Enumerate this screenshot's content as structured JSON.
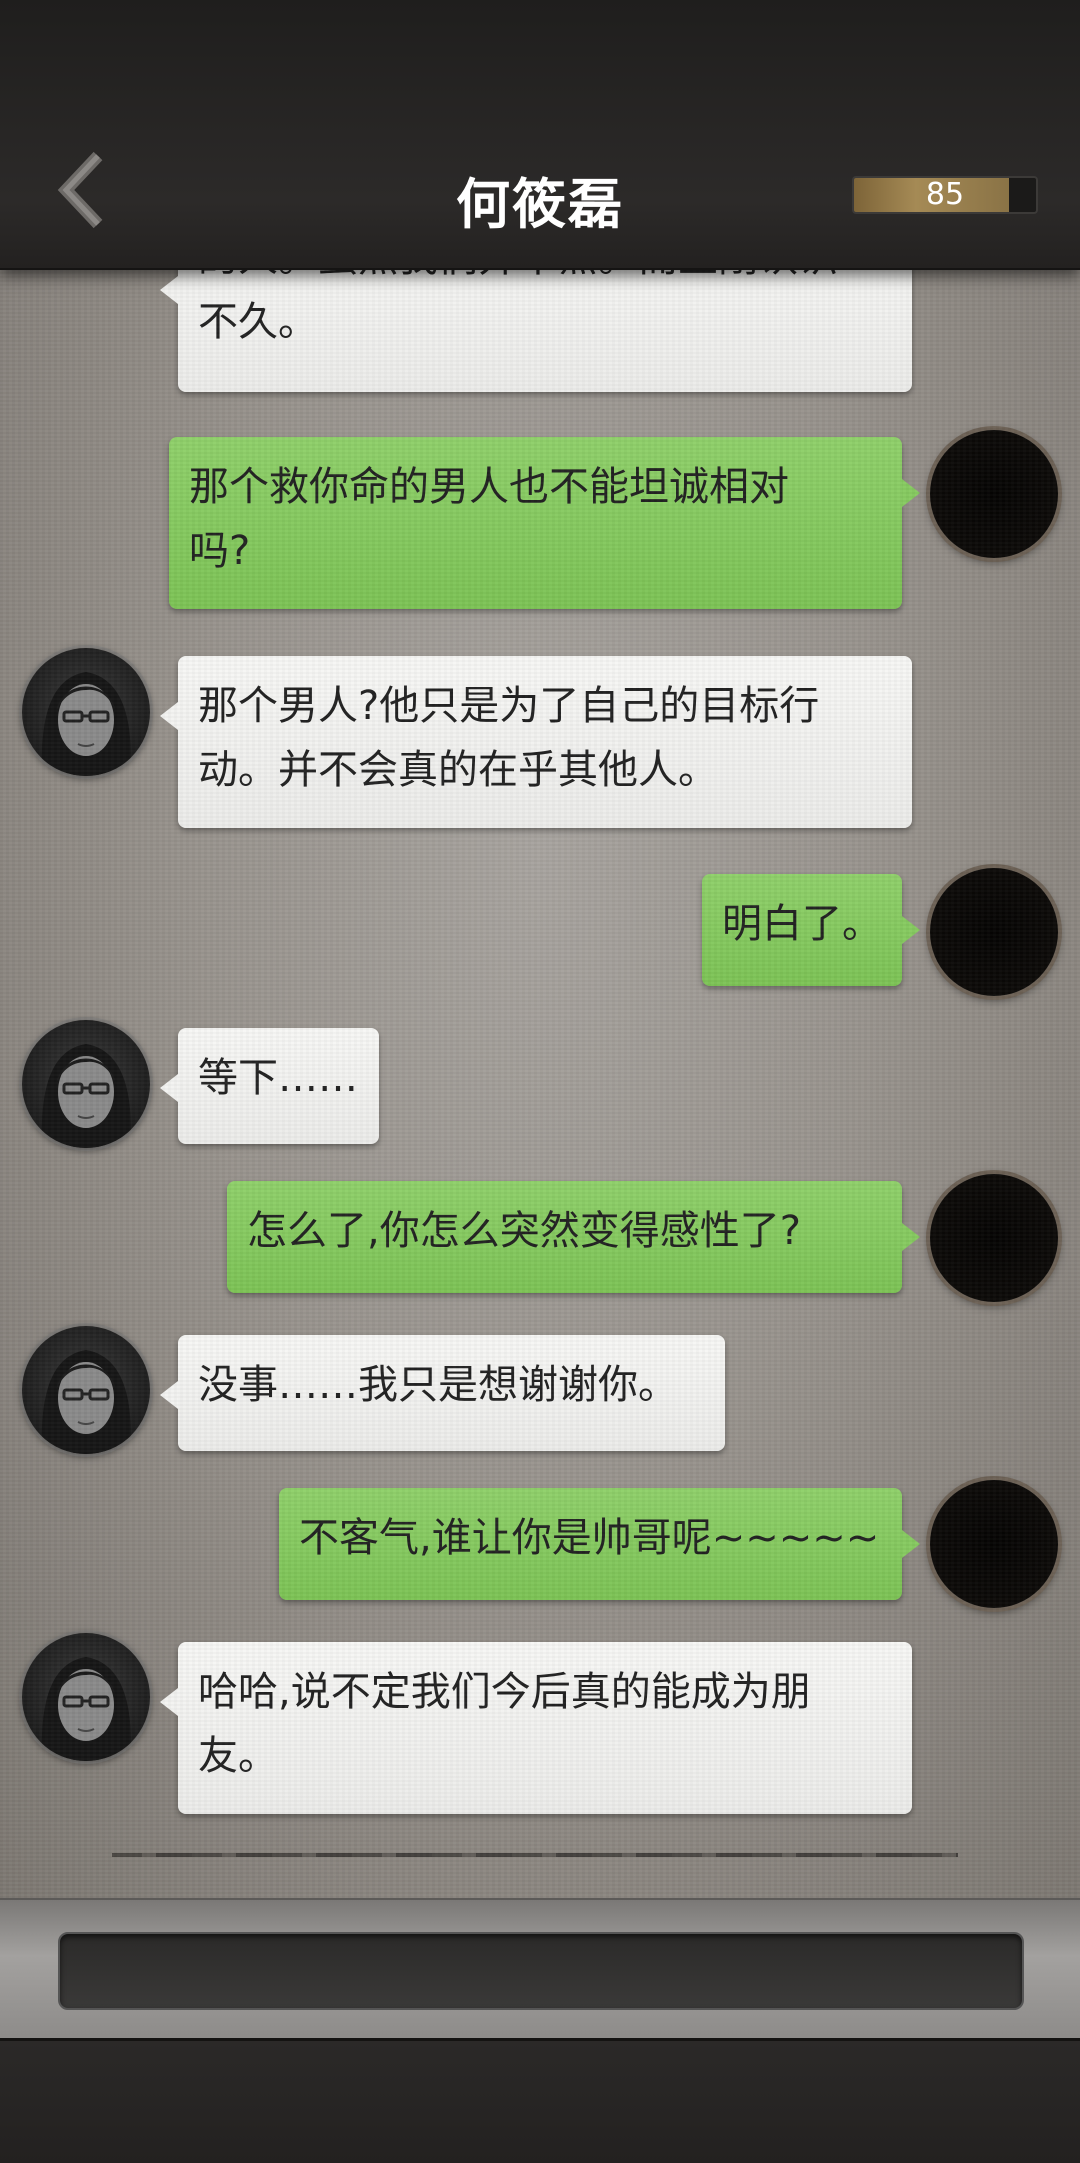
{
  "header": {
    "title": "何筱磊",
    "meter_value": "85",
    "meter_fraction": 0.85
  },
  "messages": [
    {
      "side": "left",
      "text": "的人。虽然我们并不熟。而且刚认识不久。"
    },
    {
      "side": "right",
      "text": "那个救你命的男人也不能坦诚相对吗?"
    },
    {
      "side": "left",
      "text": "那个男人?他只是为了自己的目标行动。并不会真的在乎其他人。"
    },
    {
      "side": "right",
      "text": "明白了。"
    },
    {
      "side": "left",
      "text": "等下……"
    },
    {
      "side": "right",
      "text": "怎么了,你怎么突然变得感性了?"
    },
    {
      "side": "left",
      "text": "没事……我只是想谢谢你。"
    },
    {
      "side": "right",
      "text": "不客气,谁让你是帅哥呢~~~~~"
    },
    {
      "side": "left",
      "text": "哈哈,说不定我们今后真的能成为朋友。"
    }
  ],
  "lines": {
    "m0_l1": "的人。虽然我们并不熟。而且刚认识",
    "m0_l2": "不久。",
    "m1_l1": "那个救你命的男人也不能坦诚相对",
    "m1_l2": "吗?",
    "m2_l1": "那个男人?他只是为了自己的目标行",
    "m2_l2": "动。并不会真的在乎其他人。",
    "m3_l1": "明白了。",
    "m4_l1": "等下……",
    "m5_l1": "怎么了,你怎么突然变得感性了?",
    "m6_l1": "没事……我只是想谢谢你。",
    "m7_l1": "不客气,谁让你是帅哥呢~~~~~",
    "m8_l1": "哈哈,说不定我们今后真的能成为朋",
    "m8_l2": "友。"
  },
  "icons": {
    "back": "chevron-left-icon",
    "npc_avatar": "npc-portrait-glasses",
    "user_avatar": "dark-circle-avatar"
  },
  "colors": {
    "green_bubble": "#86ca60",
    "white_bubble": "#f3f3f1",
    "header": "#2a2827",
    "meter_fill": "#a58a55"
  },
  "input": {
    "placeholder": ""
  }
}
